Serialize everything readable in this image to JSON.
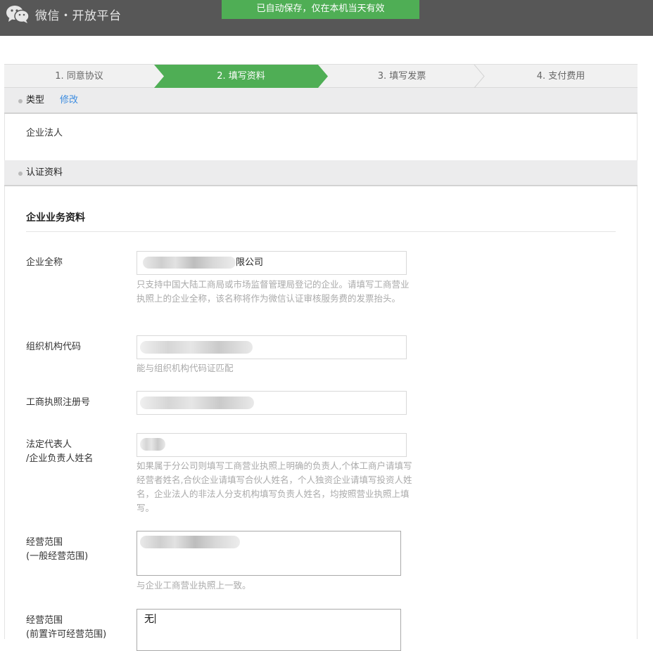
{
  "header": {
    "brand": "微信・开放平台",
    "autosave_notice": "已自动保存，仅在本机当天有效"
  },
  "steps": [
    {
      "label": "1. 同意协议",
      "active": false
    },
    {
      "label": "2. 填写资料",
      "active": true
    },
    {
      "label": "3. 填写发票",
      "active": false
    },
    {
      "label": "4. 支付费用",
      "active": false
    }
  ],
  "type_section": {
    "title": "类型",
    "edit_link": "修改",
    "value": "企业法人"
  },
  "cert_section": {
    "title": "认证资料"
  },
  "business": {
    "title": "企业业务资料",
    "fields": {
      "company_name": {
        "label": "企业全称",
        "value_suffix": "限公司",
        "hint": "只支持中国大陆工商局或市场监督管理局登记的企业。请填写工商营业执照上的企业全称，该名称将作为微信认证审核服务费的发票抬头。"
      },
      "org_code": {
        "label": "组织机构代码",
        "hint": "能与组织机构代码证匹配"
      },
      "reg_no": {
        "label": "工商执照注册号"
      },
      "legal_rep": {
        "label_line1": "法定代表人",
        "label_line2": "/企业负责人姓名",
        "hint": "如果属于分公司则填写工商营业执照上明确的负责人,个体工商户请填写经营者姓名,合伙企业请填写合伙人姓名，个人独资企业请填写投资人姓名，企业法人的非法人分支机构填写负责人姓名，均按照营业执照上填写。"
      },
      "scope_general": {
        "label_line1": "经营范围",
        "label_line2": "(一般经营范围)",
        "hint": "与企业工商营业执照上一致。"
      },
      "scope_license": {
        "label_line1": "经营范围",
        "label_line2": "(前置许可经营范围)",
        "value": "无"
      }
    }
  },
  "colors": {
    "topbar": "#575757",
    "toast": "#4fae55",
    "step_active": "#4fae55",
    "link": "#3c8ce0"
  }
}
